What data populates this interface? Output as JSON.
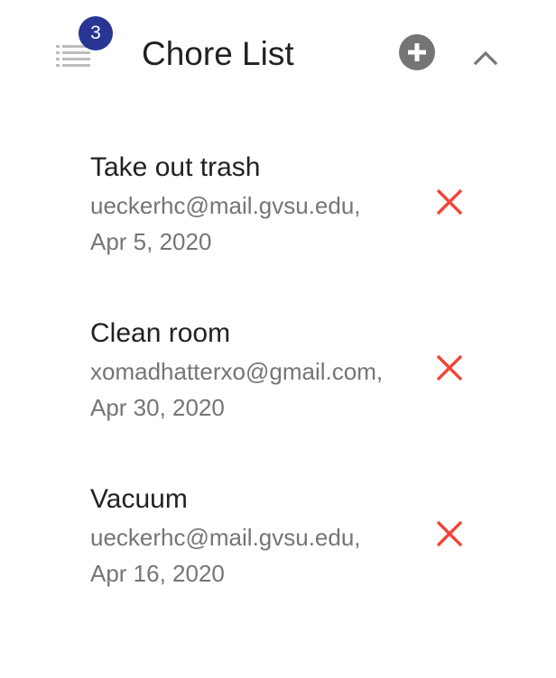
{
  "header": {
    "badge_count": "3",
    "title": "Chore List",
    "icons": {
      "list": "list-icon",
      "add": "add-circle-icon",
      "collapse": "chevron-up-icon"
    }
  },
  "chores": [
    {
      "title": "Take out trash",
      "email": "ueckerhc@mail.gvsu.edu,",
      "date": "Apr 5, 2020"
    },
    {
      "title": "Clean room",
      "email": "xomadhatterxo@gmail.com,",
      "date": "Apr 30, 2020"
    },
    {
      "title": "Vacuum",
      "email": "ueckerhc@mail.gvsu.edu,",
      "date": "Apr 16, 2020"
    }
  ],
  "colors": {
    "badge": "#283593",
    "delete": "#f44336",
    "icon_gray": "#757575",
    "text": "#212121",
    "secondary_text": "#757575"
  }
}
